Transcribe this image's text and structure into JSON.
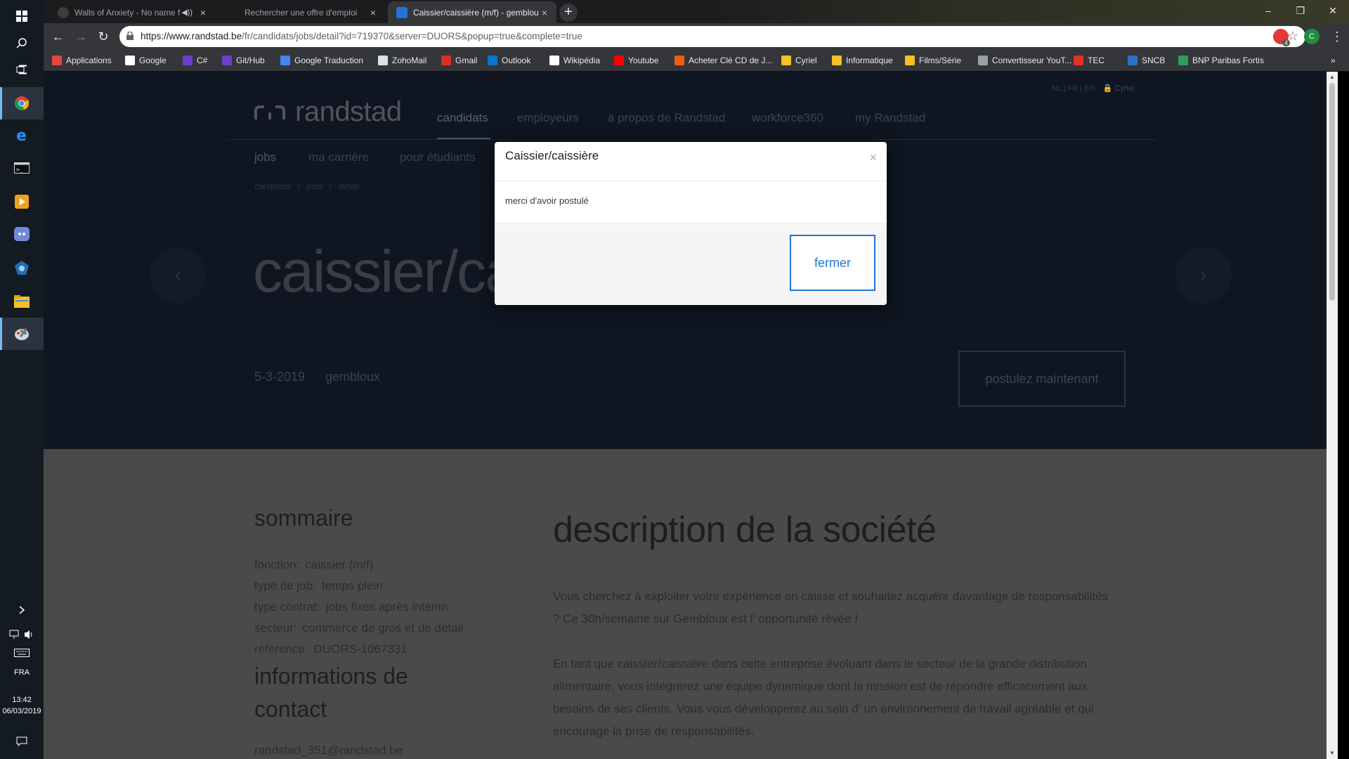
{
  "taskbar": {
    "clock_time": "13:42",
    "clock_date": "06/03/2019",
    "lang": "FRA",
    "icons": [
      "windows-start-icon",
      "search-icon",
      "task-view-icon",
      "chrome-icon",
      "edge-icon",
      "terminal-icon",
      "media-player-icon",
      "discord-icon",
      "app-icon",
      "file-explorer-icon",
      "paint-icon"
    ]
  },
  "browser": {
    "tabs": [
      {
        "title": "Walls of Anxiety - No name f",
        "active": false
      },
      {
        "title": "Rechercher une offre d'emploi",
        "active": false
      },
      {
        "title": "Caissier/caissière (m/f) - gemblou",
        "active": true
      }
    ],
    "url_host": "https://www.randstad.be",
    "url_path": "/fr/candidats/jobs/detail?id=719370&server=DUORS&popup=true&complete=true",
    "extension_badge": "4",
    "profile_initial": "C",
    "bookmarks": [
      {
        "label": "Applications",
        "color": "#e8453c"
      },
      {
        "label": "Google",
        "color": "#ffffff"
      },
      {
        "label": "C#",
        "color": "#6c3fcf"
      },
      {
        "label": "Git/Hub",
        "color": "#6c3fcf"
      },
      {
        "label": "Google Traduction",
        "color": "#4285f4"
      },
      {
        "label": "ZohoMail",
        "color": "#d8e2ef"
      },
      {
        "label": "Gmail",
        "color": "#d93025"
      },
      {
        "label": "Outlook",
        "color": "#0078d4"
      },
      {
        "label": "Wikipédia",
        "color": "#ffffff"
      },
      {
        "label": "Youtube",
        "color": "#ff0000"
      },
      {
        "label": "Acheter Clé CD de J...",
        "color": "#f45c14"
      },
      {
        "label": "Cyriel",
        "color": "#f6c026"
      },
      {
        "label": "Informatique",
        "color": "#f6c026"
      },
      {
        "label": "Films/Série",
        "color": "#f6c026"
      },
      {
        "label": "Convertisseur YouT...",
        "color": "#9aa0a6"
      },
      {
        "label": "TEC",
        "color": "#e63027"
      },
      {
        "label": "SNCB",
        "color": "#2a72c9"
      },
      {
        "label": "BNP Paribas Fortis",
        "color": "#2e9c5a"
      }
    ],
    "more_bookmarks": "»"
  },
  "site": {
    "logo_text": "randstad",
    "languages": [
      "NL",
      "FR",
      "EN"
    ],
    "user": "Cyriel",
    "main_nav": [
      "candidats",
      "employeurs",
      "à propos de Randstad",
      "workforce360",
      "my Randstad"
    ],
    "sub_nav": [
      "jobs",
      "ma carrière",
      "pour étudiants"
    ],
    "breadcrumb": [
      "candidats",
      "/",
      "jobs",
      "/",
      "détail"
    ],
    "job_title": "caissier/caissière (m/f)",
    "date": "5-3-2019",
    "location": "gembloux",
    "apply_label": "postulez maintenant",
    "summary_heading": "sommaire",
    "summary": [
      {
        "k": "fonction:",
        "v": "caissier (m/f)"
      },
      {
        "k": "type de job:",
        "v": "temps plein"
      },
      {
        "k": "type contrat:",
        "v": "jobs fixes après intérim"
      },
      {
        "k": "secteur:",
        "v": "commerce de gros et de détail"
      },
      {
        "k": "référence:",
        "v": "DUORS-1067331"
      }
    ],
    "contact_heading_1": "informations de",
    "contact_heading_2": "contact",
    "contact_email": "randstad_351@randstad.be",
    "description_heading": "description de la société",
    "description_p1": "Vous cherchez à exploiter votre expérience en caisse et souhaitez acquérir davantage de responsabilités ? Ce 30h/semaine sur Gembloux est l' opportunité rêvée !",
    "description_p2": "En tant que caissier/caissière dans cette entreprise évoluant dans le secteur de la grande distribution alimentaire, vous intégrerez une équipe dynamique dont la mission est de répondre efficacement aux besoins de ses clients. Vous vous développerez au sein d' un environnement de travail agréable et qui encourage la prise de responsabilités."
  },
  "modal": {
    "title": "Caissier/caissière",
    "close": "×",
    "message": "merci d'avoir postulé",
    "button": "fermer"
  },
  "colors": {
    "accent_blue": "#2175d9",
    "hero_bg": "#0f1621",
    "chrome_dark": "#35363a"
  }
}
